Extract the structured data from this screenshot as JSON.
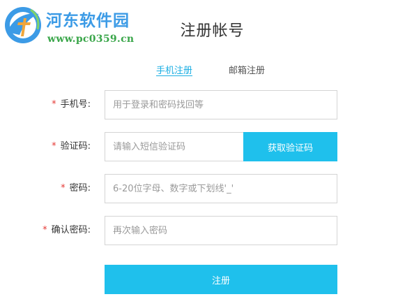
{
  "watermark": {
    "title": "河东软件园",
    "url": "www.pc0359.cn"
  },
  "page_title": "注册帐号",
  "tabs": {
    "phone": "手机注册",
    "email": "邮箱注册"
  },
  "required_mark": "*",
  "form": {
    "phone": {
      "label": "手机号:",
      "placeholder": "用于登录和密码找回等",
      "value": ""
    },
    "code": {
      "label": "验证码:",
      "placeholder": "请输入短信验证码",
      "value": "",
      "button_label": "获取验证码"
    },
    "password": {
      "label": "密码:",
      "placeholder": "6-20位字母、数字或下划线'_'",
      "value": ""
    },
    "confirm": {
      "label": "确认密码:",
      "placeholder": "再次输入密码",
      "value": ""
    },
    "submit_label": "注册"
  },
  "colors": {
    "accent": "#1fc0ec",
    "required": "#e53935",
    "active_tab": "#1aaee3"
  },
  "icons": {
    "logo": "hedong-logo-icon"
  }
}
